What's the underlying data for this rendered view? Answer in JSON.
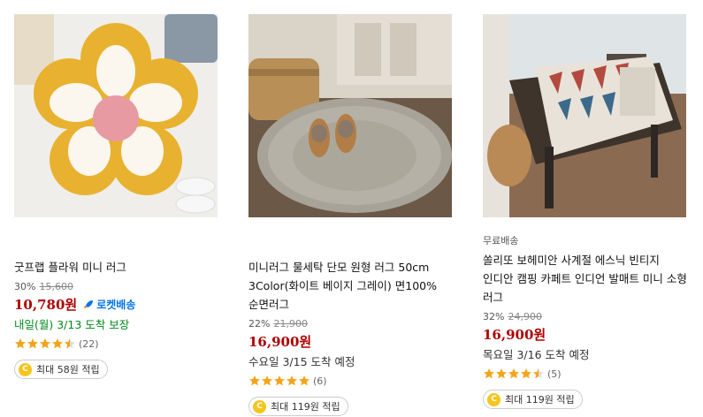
{
  "products": [
    {
      "badge": "",
      "title": "굿프랩 플라워 미니 러그",
      "discount_rate": "30%",
      "original_price": "15,600",
      "price": "10,780원",
      "rocket_label": "로켓배송",
      "delivery": "내일(월) 3/13 도착 보장",
      "rating": 4.5,
      "review_count": "(22)",
      "points_label": "최대 58원 적립",
      "image_icon": "flower-rug-image"
    },
    {
      "badge": "",
      "title": "미니러그 물세탁 단모 원형 러그 50cm 3Color(화이트 베이지 그레이) 면100% 순면러그",
      "discount_rate": "22%",
      "original_price": "21,900",
      "price": "16,900원",
      "rocket_label": "",
      "delivery": "수요일 3/15 도착 예정",
      "rating": 5,
      "review_count": "(6)",
      "points_label": "최대 119원 적립",
      "image_icon": "round-rug-image"
    },
    {
      "badge": "무료배송",
      "title": "쏠리또 보헤미안 사계절 에스닉 빈티지 인디안 캠핑 카페트 인디언 발매트 미니 소형 러그",
      "discount_rate": "32%",
      "original_price": "24,900",
      "price": "16,900원",
      "rocket_label": "",
      "delivery": "목요일 3/16 도착 예정",
      "rating": 4.5,
      "review_count": "(5)",
      "points_label": "최대 119원 적립",
      "image_icon": "ethnic-rug-image"
    }
  ],
  "coin_symbol": "C",
  "colors": {
    "price": "#ae0000",
    "rocket": "#0073e9",
    "delivery_green": "#00891a",
    "star": "#f2a51a"
  }
}
